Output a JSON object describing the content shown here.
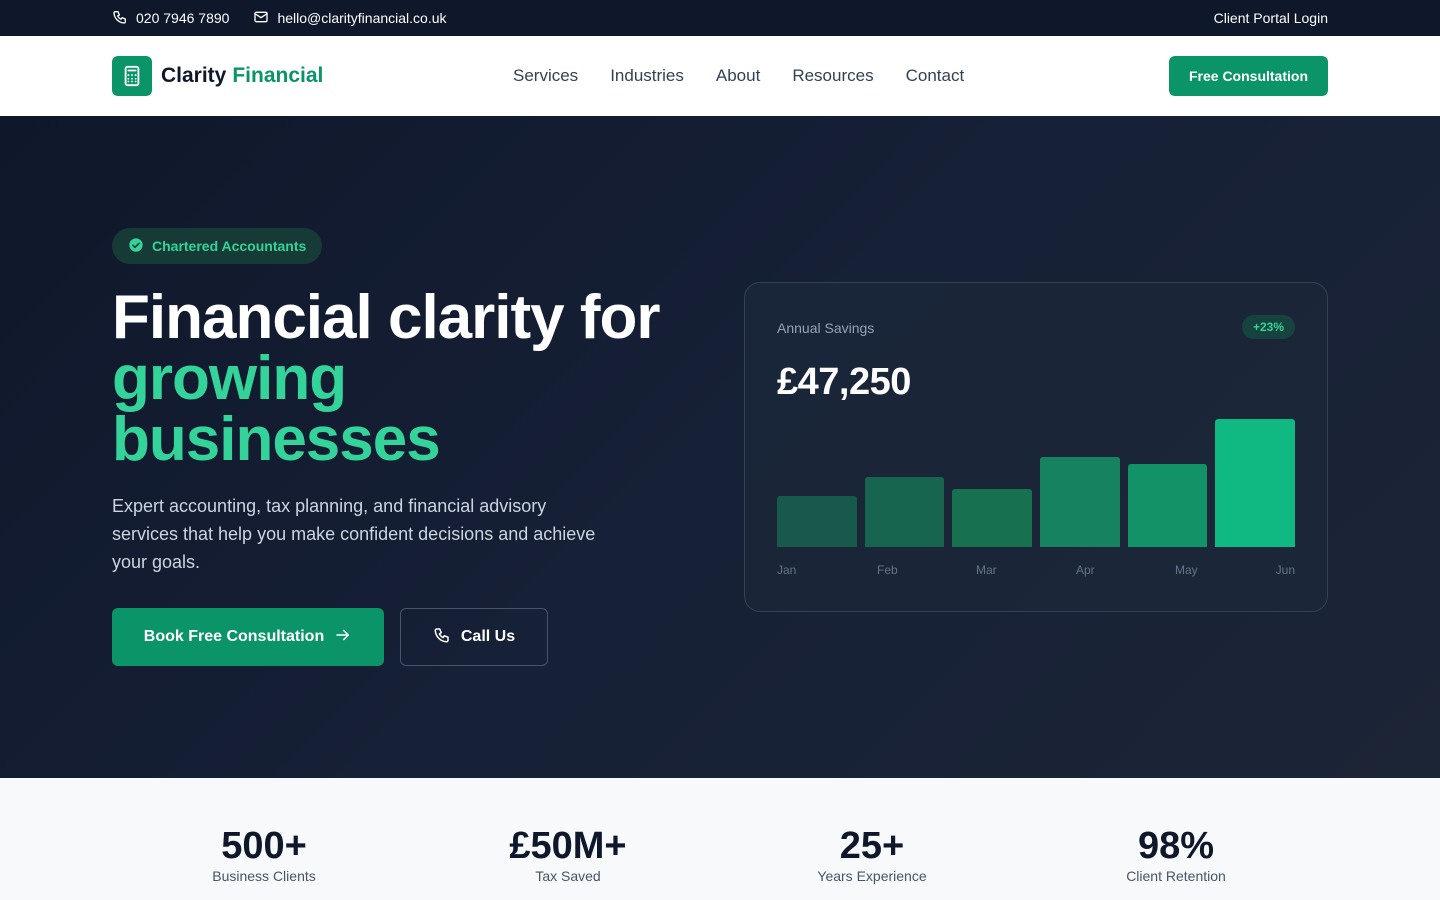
{
  "topbar": {
    "phone": "020 7946 7890",
    "email": "hello@clarityfinancial.co.uk",
    "portal_label": "Client Portal Login"
  },
  "brand": {
    "name_primary": "Clarity",
    "name_accent": "Financial",
    "color": "#0b9467"
  },
  "nav": {
    "items": [
      "Services",
      "Industries",
      "About",
      "Resources",
      "Contact"
    ],
    "cta_label": "Free Consultation"
  },
  "hero": {
    "badge": "Chartered Accountants",
    "headline_line1": "Financial clarity for",
    "headline_line2": "growing",
    "headline_line3": "businesses",
    "lead": "Expert accounting, tax planning, and financial advisory services that help you make confident decisions and achieve your goals.",
    "primary_cta": "Book Free Consultation",
    "secondary_cta": "Call Us",
    "accent_color": "#34d399"
  },
  "card": {
    "label": "Annual Savings",
    "delta": "+23%",
    "value": "£47,250",
    "months": [
      "Jan",
      "Feb",
      "Mar",
      "Apr",
      "May",
      "Jun"
    ],
    "bar_levels": [
      0.4,
      0.55,
      0.45,
      0.7,
      0.65,
      1.0
    ],
    "bar_colors": [
      "#17594a",
      "#17654f",
      "#17704f",
      "#168260",
      "#139167",
      "#10b981"
    ]
  },
  "stats": [
    {
      "value": "500+",
      "label": "Business Clients"
    },
    {
      "value": "£50M+",
      "label": "Tax Saved"
    },
    {
      "value": "25+",
      "label": "Years Experience"
    },
    {
      "value": "98%",
      "label": "Client Retention"
    }
  ]
}
